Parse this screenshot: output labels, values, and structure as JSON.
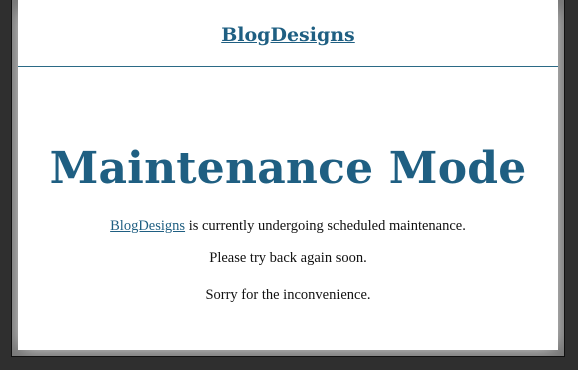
{
  "header": {
    "site_name": "BlogDesigns"
  },
  "main": {
    "title": "Maintenance Mode",
    "line1_link": "BlogDesigns",
    "line1_rest": " is currently undergoing scheduled maintenance.",
    "line2": "Please try back again soon.",
    "line3": "Sorry for the inconvenience."
  },
  "colors": {
    "accent": "#1f5f82",
    "text": "#111111",
    "background": "#ffffff",
    "frame": "#2f2f2f"
  }
}
